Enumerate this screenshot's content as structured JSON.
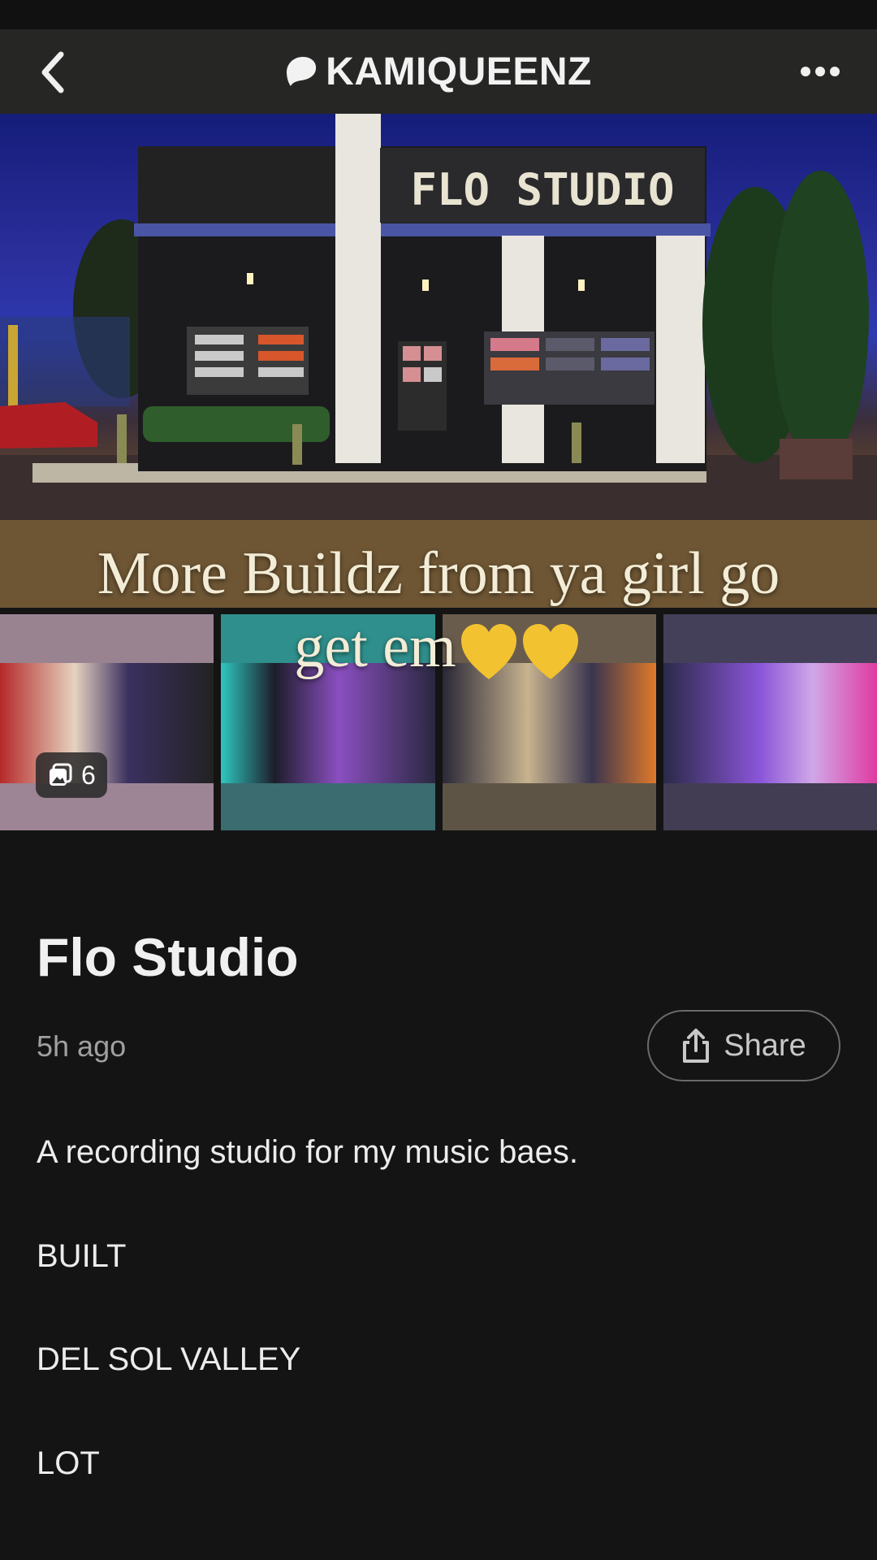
{
  "header": {
    "brand": "KAMIQUEENZ"
  },
  "hero": {
    "sign_text": "FLO STUDIO",
    "caption_line1": "More Buildz from ya girl go",
    "caption_line2": "get em"
  },
  "gallery": {
    "count": "6"
  },
  "post": {
    "title": "Flo Studio",
    "time": "5h ago",
    "share_label": "Share",
    "description": "A recording studio for my music baes.",
    "lines": [
      "BUILT",
      "DEL SOL VALLEY",
      "LOT"
    ]
  }
}
